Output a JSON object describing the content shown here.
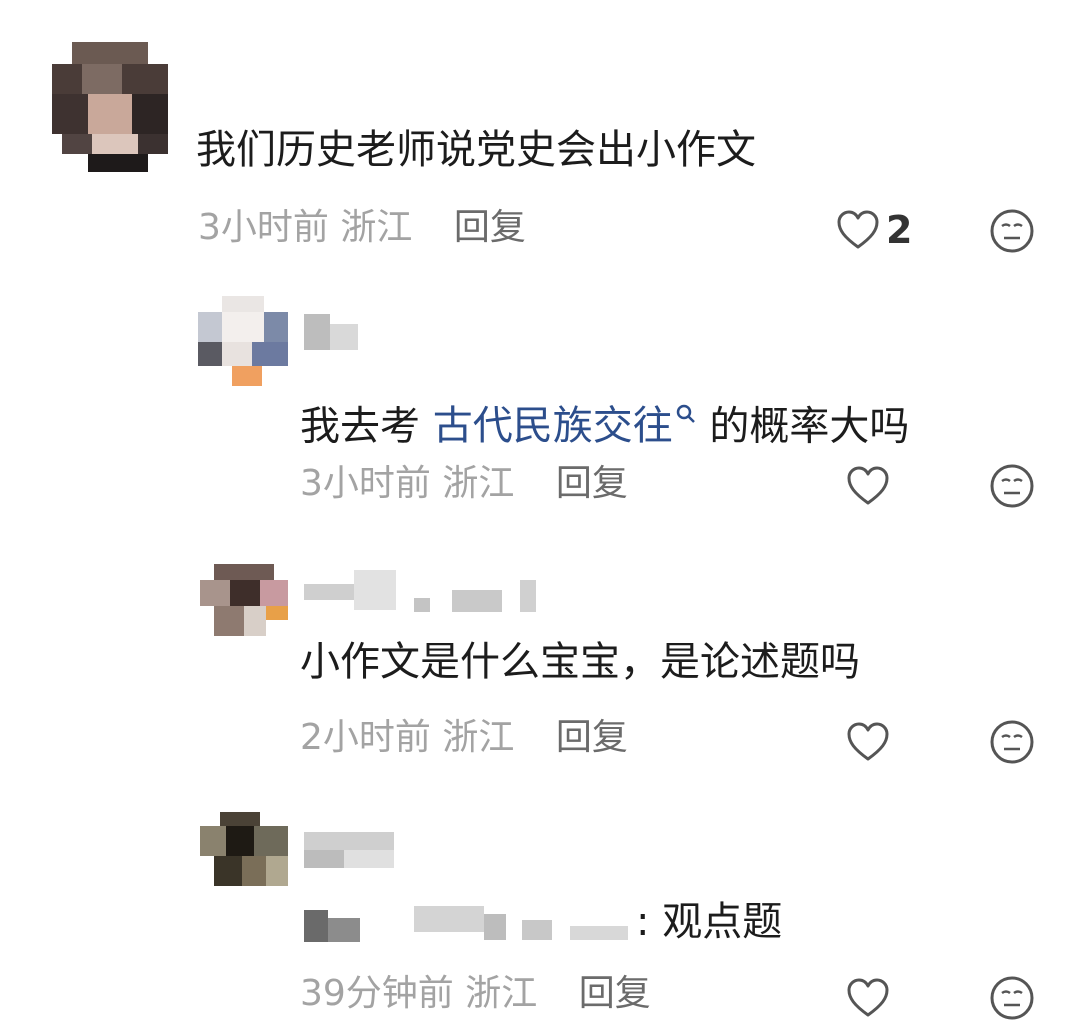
{
  "comments": [
    {
      "text": "我们历史老师说党史会出小作文",
      "time": "3小时前",
      "location": "浙江",
      "reply_label": "回复",
      "like_count": "2"
    },
    {
      "text_before": "我去考 ",
      "link_text": "古代民族交往",
      "text_after": " 的概率大吗",
      "time": "3小时前",
      "location": "浙江",
      "reply_label": "回复"
    },
    {
      "text": "小作文是什么宝宝，是论述题吗",
      "time": "2小时前",
      "location": "浙江",
      "reply_label": "回复"
    },
    {
      "text": ": 观点题",
      "time": "39分钟前",
      "location": "浙江",
      "reply_label": "回复"
    }
  ],
  "colors": {
    "link": "#2c4e8c",
    "meta": "#a3a3a3",
    "icon": "#555555"
  },
  "icons": {
    "like": "heart-outline-icon",
    "emoji": "neutral-face-icon",
    "search": "search-icon"
  }
}
